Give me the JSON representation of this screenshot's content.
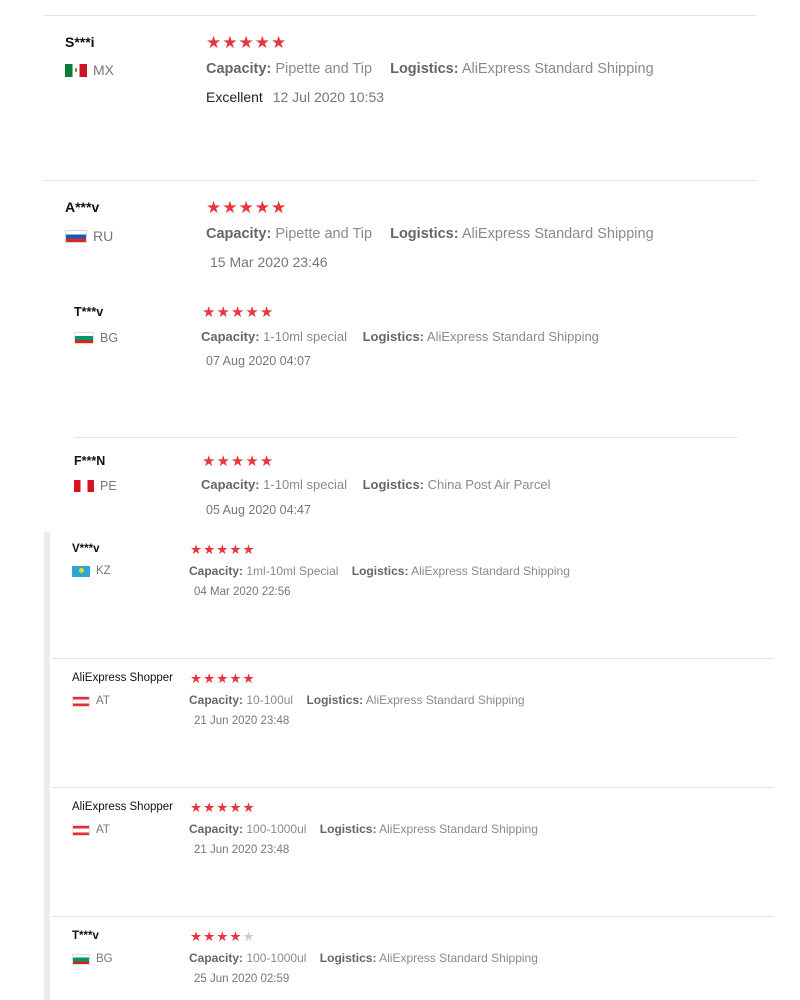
{
  "reviews": [
    {
      "user": "S***i",
      "country": "MX",
      "flag_icon": "mexico-flag-icon",
      "rating": 5,
      "capacity_label": "Capacity:",
      "capacity_value": "Pipette and Tip",
      "logistics_label": "Logistics:",
      "logistics_value": "AliExpress Standard Shipping",
      "feedback": "Excellent",
      "date": "12 Jul 2020 10:53"
    },
    {
      "user": "A***v",
      "country": "RU",
      "flag_icon": "russia-flag-icon",
      "rating": 5,
      "capacity_label": "Capacity:",
      "capacity_value": "Pipette and Tip",
      "logistics_label": "Logistics:",
      "logistics_value": "AliExpress Standard Shipping",
      "feedback": "",
      "date": "15 Mar 2020 23:46"
    },
    {
      "user": "T***v",
      "country": "BG",
      "flag_icon": "bulgaria-flag-icon",
      "rating": 5,
      "capacity_label": "Capacity:",
      "capacity_value": "1-10ml special",
      "logistics_label": "Logistics:",
      "logistics_value": "AliExpress Standard Shipping",
      "feedback": "",
      "date": "07 Aug 2020 04:07"
    },
    {
      "user": "F***N",
      "country": "PE",
      "flag_icon": "peru-flag-icon",
      "rating": 5,
      "capacity_label": "Capacity:",
      "capacity_value": "1-10ml special",
      "logistics_label": "Logistics:",
      "logistics_value": "China Post Air Parcel",
      "feedback": "",
      "date": "05 Aug 2020 04:47"
    },
    {
      "user": "V***v",
      "country": "KZ",
      "flag_icon": "kazakhstan-flag-icon",
      "rating": 5,
      "capacity_label": "Capacity:",
      "capacity_value": "1ml-10ml Special",
      "logistics_label": "Logistics:",
      "logistics_value": "AliExpress Standard Shipping",
      "feedback": "",
      "date": "04 Mar 2020 22:56"
    },
    {
      "user": "AliExpress Shopper",
      "country": "AT",
      "flag_icon": "austria-flag-icon",
      "rating": 5,
      "capacity_label": "Capacity:",
      "capacity_value": "10-100ul",
      "logistics_label": "Logistics:",
      "logistics_value": "AliExpress Standard Shipping",
      "feedback": "",
      "date": "21 Jun 2020 23:48"
    },
    {
      "user": "AliExpress Shopper",
      "country": "AT",
      "flag_icon": "austria-flag-icon",
      "rating": 5,
      "capacity_label": "Capacity:",
      "capacity_value": "100-1000ul",
      "logistics_label": "Logistics:",
      "logistics_value": "AliExpress Standard Shipping",
      "feedback": "",
      "date": "21 Jun 2020 23:48"
    },
    {
      "user": "T***v",
      "country": "BG",
      "flag_icon": "bulgaria-flag-icon",
      "rating": 4,
      "capacity_label": "Capacity:",
      "capacity_value": "100-1000ul",
      "logistics_label": "Logistics:",
      "logistics_value": "AliExpress Standard Shipping",
      "feedback": "",
      "date": "25 Jun 2020 02:59"
    }
  ],
  "colors": {
    "star_on": "#e8363f",
    "star_off": "#cfcfcf"
  },
  "star_glyph": "★"
}
